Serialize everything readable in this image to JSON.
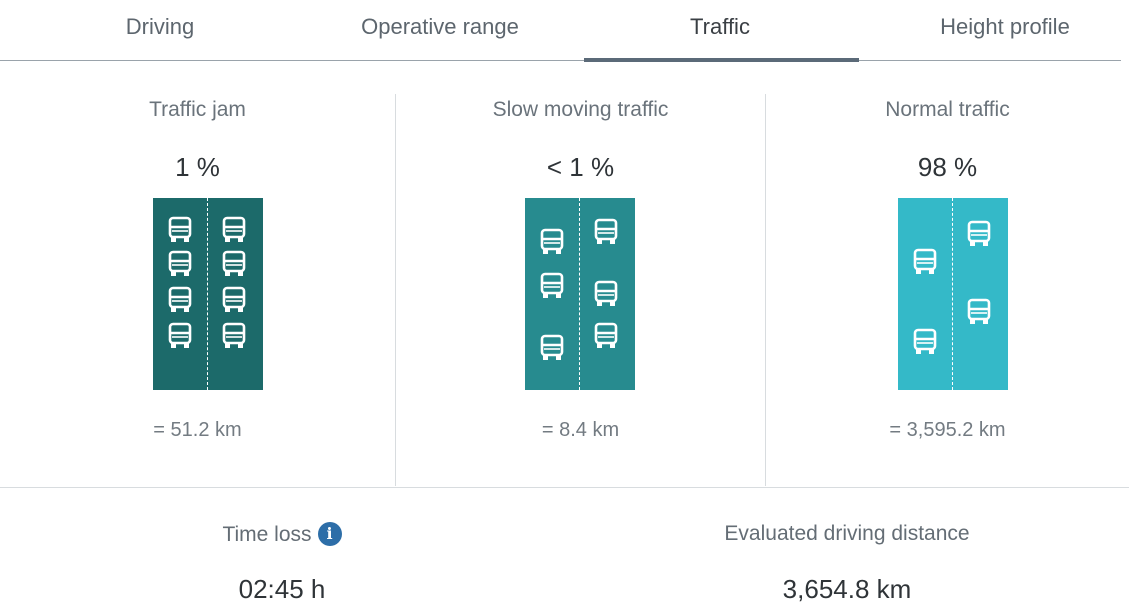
{
  "tabs": [
    {
      "label": "Driving",
      "active": false
    },
    {
      "label": "Operative range",
      "active": false
    },
    {
      "label": "Traffic",
      "active": true
    },
    {
      "label": "Height profile",
      "active": false
    }
  ],
  "traffic": [
    {
      "title": "Traffic jam",
      "percent": "1 %",
      "distance": "= 51.2 km",
      "color": "#1c6a6a"
    },
    {
      "title": "Slow moving traffic",
      "percent": "< 1 %",
      "distance": "= 8.4 km",
      "color": "#278b8f"
    },
    {
      "title": "Normal traffic",
      "percent": "98 %",
      "distance": "= 3,595.2 km",
      "color": "#34b9c8"
    }
  ],
  "summary": {
    "time_loss_label": "Time loss",
    "time_loss_value": "02:45 h",
    "distance_label": "Evaluated driving distance",
    "distance_value": "3,654.8 km"
  },
  "icons": {
    "info": "info-icon",
    "truck": "truck-icon"
  },
  "colors": {
    "accent": "#5b6a78",
    "info": "#2d6ea8"
  }
}
